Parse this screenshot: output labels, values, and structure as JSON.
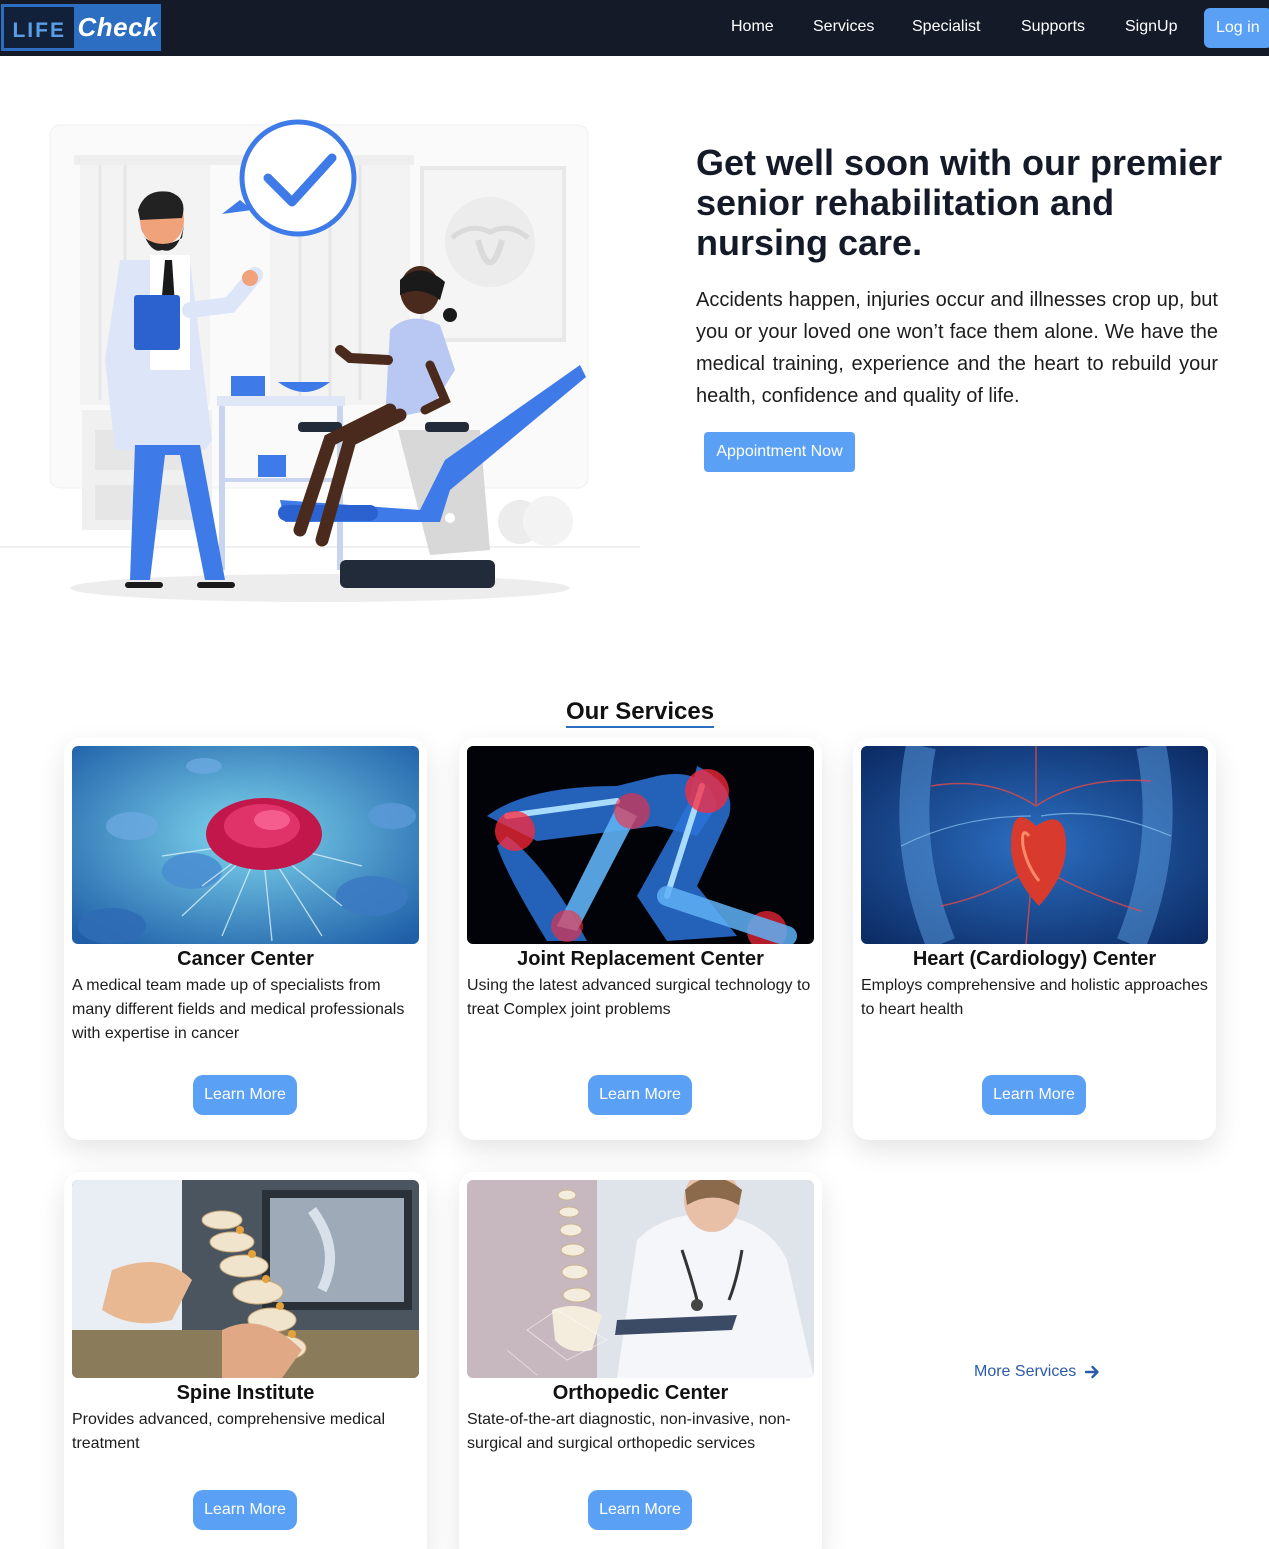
{
  "navbar": {
    "logo_left": "LIFE",
    "logo_right": "Check",
    "links": [
      "Home",
      "Services",
      "Specialist",
      "Supports",
      "SignUp"
    ],
    "login": "Log in"
  },
  "hero": {
    "title": "Get well soon with our premier senior rehabilitation and nursing care.",
    "text": "Accidents happen, injuries occur and illnesses crop up, but you or your loved one won’t face them alone. We have the medical training, experience and the heart to rebuild your health, confidence and quality of life.",
    "button": "Appointment Now"
  },
  "services": {
    "title": "Our Services",
    "cards": [
      {
        "title": "Cancer Center",
        "desc": "A medical team made up of specialists from many different fields and medical professionals with expertise in cancer",
        "button": "Learn More"
      },
      {
        "title": "Joint Replacement Center",
        "desc": "Using the latest advanced surgical technology to treat Complex joint problems",
        "button": "Learn More"
      },
      {
        "title": "Heart (Cardiology) Center",
        "desc": "Employs comprehensive and holistic approaches to heart health",
        "button": "Learn More"
      },
      {
        "title": "Spine Institute",
        "desc": "Provides advanced, comprehensive medical treatment",
        "button": "Learn More"
      },
      {
        "title": "Orthopedic Center",
        "desc": "State-of-the-art diagnostic, non-invasive, non-surgical and surgical orthopedic services",
        "button": "Learn More"
      }
    ],
    "more": "More Services"
  },
  "colors": {
    "navbar_bg": "#141a28",
    "accent_button": "#5aa0f5",
    "brand_blue": "#2c6fc2",
    "link_blue": "#2c5aa8"
  }
}
